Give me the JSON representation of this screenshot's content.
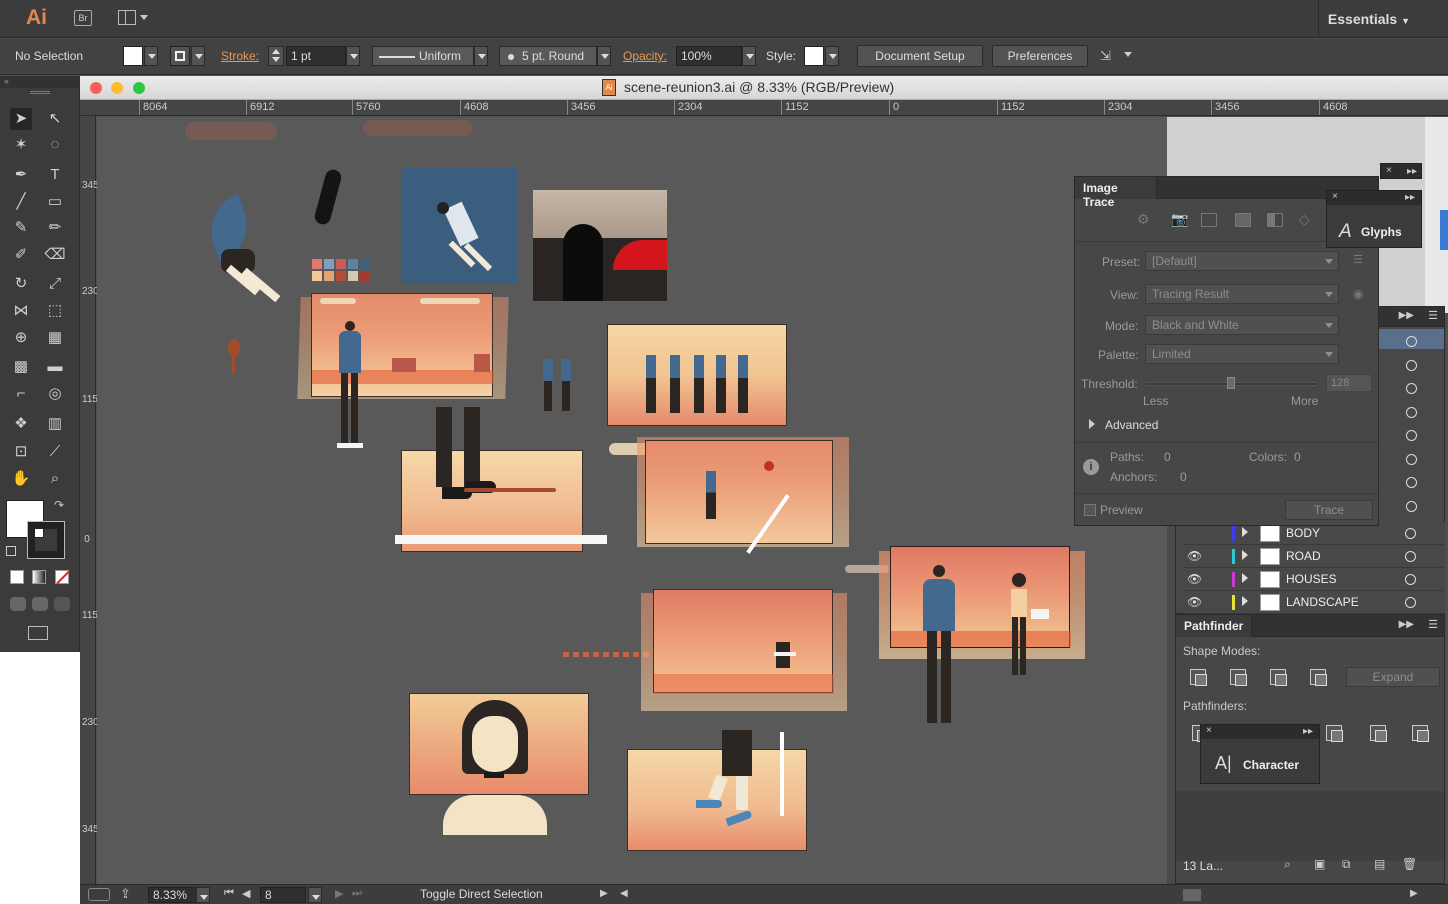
{
  "app": {
    "logo": "Ai",
    "bridge_label": "Br",
    "workspace": "Essentials"
  },
  "control_bar": {
    "selection": "No Selection",
    "stroke_label": "Stroke:",
    "stroke_weight": "1 pt",
    "stroke_profile": "Uniform",
    "brush": "5 pt. Round",
    "opacity_label": "Opacity:",
    "opacity_value": "100%",
    "style_label": "Style:",
    "document_setup": "Document Setup",
    "preferences": "Preferences"
  },
  "document": {
    "title": "scene-reunion3.ai @ 8.33% (RGB/Preview)",
    "ruler_h": [
      "8064",
      "6912",
      "5760",
      "4608",
      "3456",
      "2304",
      "1152",
      "0",
      "1152",
      "2304",
      "3456",
      "4608"
    ],
    "ruler_v": [
      "3456",
      "2304",
      "1152",
      "0",
      "1152",
      "2304",
      "3456"
    ]
  },
  "status_bar": {
    "zoom": "8.33%",
    "artboard": "8",
    "tool_hint": "Toggle Direct Selection"
  },
  "image_trace": {
    "title": "Image Trace",
    "preset_label": "Preset:",
    "preset_value": "[Default]",
    "view_label": "View:",
    "view_value": "Tracing Result",
    "mode_label": "Mode:",
    "mode_value": "Black and White",
    "palette_label": "Palette:",
    "palette_value": "Limited",
    "threshold_label": "Threshold:",
    "threshold_value": "128",
    "threshold_level": 0.5,
    "less": "Less",
    "more": "More",
    "advanced": "Advanced",
    "paths_label": "Paths:",
    "paths_value": "0",
    "colors_label": "Colors:",
    "colors_value": "0",
    "anchors_label": "Anchors:",
    "anchors_value": "0",
    "preview": "Preview",
    "trace": "Trace"
  },
  "glyphs_panel": {
    "label": "Glyphs",
    "icon": "A"
  },
  "character_panel": {
    "label": "Character",
    "icon": "A|"
  },
  "layers": {
    "rows": [
      {
        "name": "BODY",
        "color": "#3c3cf0",
        "eye": ""
      },
      {
        "name": "ROAD",
        "color": "#2ec9d4",
        "eye": "👁"
      },
      {
        "name": "HOUSES",
        "color": "#c83cd2",
        "eye": "👁"
      },
      {
        "name": "LANDSCAPE",
        "color": "#e8e23a",
        "eye": "👁"
      }
    ],
    "count": "13 La..."
  },
  "pathfinder": {
    "title": "Pathfinder",
    "shape_modes": "Shape Modes:",
    "expand": "Expand",
    "pathfinders": "Pathfinders:"
  }
}
